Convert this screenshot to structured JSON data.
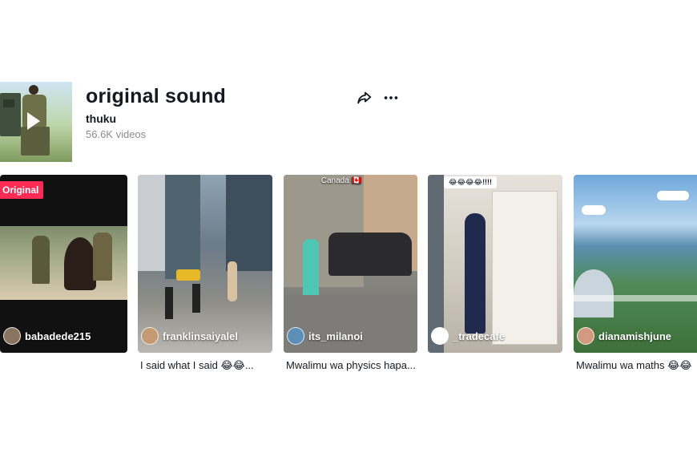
{
  "sound": {
    "title": "original sound",
    "author": "thuku",
    "video_count": "56.6K videos"
  },
  "icons": {
    "share": "share-icon",
    "more": "more-icon",
    "play": "play-icon"
  },
  "videos": [
    {
      "username": "babadede215",
      "badge": "Original",
      "caption": ""
    },
    {
      "username": "franklinsaiyalel",
      "caption": "I said what I said 😂😂..."
    },
    {
      "username": "its_milanoi",
      "tag": "Canada 🇨🇦",
      "caption": "Mwalimu wa physics hapa..."
    },
    {
      "username": "_tradecafe",
      "overlay": "😂😂😂😂!!!!",
      "caption": ""
    },
    {
      "username": "dianamishjune",
      "caption": "Mwalimu wa maths 😂😂"
    }
  ],
  "colors": {
    "badge": "#fe2c55",
    "text_primary": "#161823",
    "text_secondary": "#8a8b91"
  }
}
